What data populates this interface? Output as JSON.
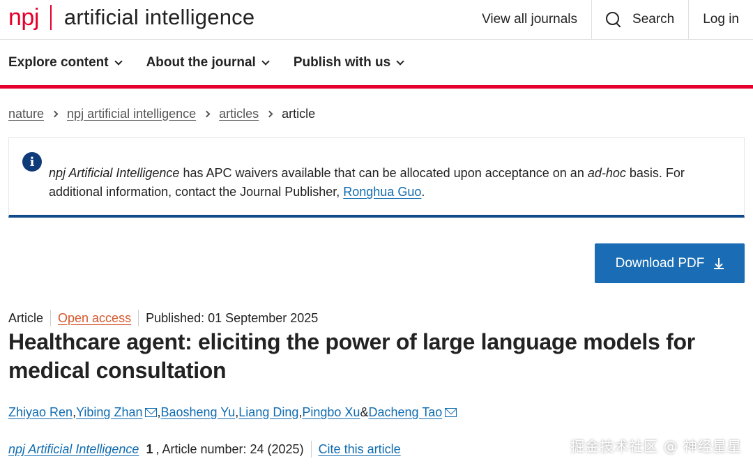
{
  "header": {
    "logo_brand": "npj",
    "logo_title": "artificial intelligence",
    "nav": {
      "view_all": "View all journals",
      "search": "Search",
      "login": "Log in"
    }
  },
  "subnav": {
    "items": [
      "Explore content",
      "About the journal",
      "Publish with us"
    ]
  },
  "breadcrumb": {
    "items": [
      "nature",
      "npj artificial intelligence",
      "articles"
    ],
    "current": "article"
  },
  "notice": {
    "journal": "npj Artificial Intelligence",
    "text_1": " has APC waivers available that can be allocated upon acceptance on an ",
    "adhoc": "ad-hoc",
    "text_2": " basis. For additional information, contact the Journal Publisher, ",
    "contact": "Ronghua Guo",
    "text_3": "."
  },
  "download_label": "Download PDF",
  "article": {
    "type": "Article",
    "access": "Open access",
    "published": "Published: 01 September 2025",
    "title": "Healthcare agent: eliciting the power of large language models for medical consultation"
  },
  "authors": {
    "list": [
      "Zhiyao Ren",
      "Yibing Zhan",
      "Baosheng Yu",
      "Liang Ding",
      "Pingbo Xu",
      "Dacheng Tao"
    ],
    "sep": ", ",
    "amp": " & "
  },
  "citation": {
    "journal": "npj Artificial Intelligence",
    "volume": "1",
    "details": ", Article number: 24 (2025)",
    "cite": "Cite this article"
  },
  "watermark": "掘金技术社区 @ 神经星星",
  "colors": {
    "brand_red": "#e4002b",
    "link_blue": "#0f6bb0",
    "button_blue": "#1a6db4",
    "open_access_orange": "#d5572c",
    "notice_border": "#0f4a8a"
  },
  "icons": {
    "search": "search-icon",
    "chevron": "chevron-down-icon",
    "info": "info-icon",
    "download": "download-icon",
    "mail": "mail-icon"
  }
}
